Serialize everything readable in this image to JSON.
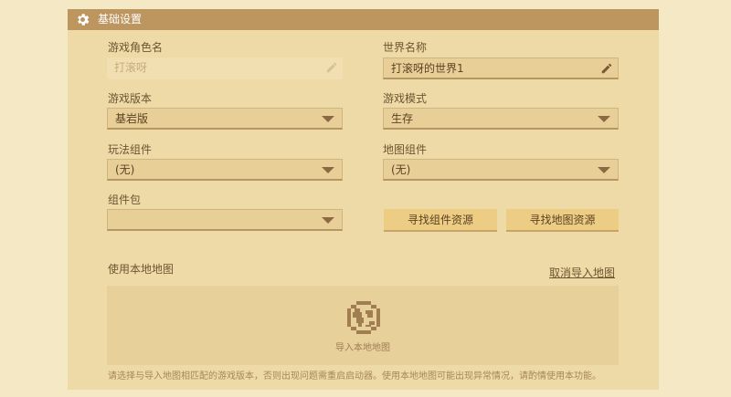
{
  "panel": {
    "title": "基础设置",
    "icon": "gear-icon"
  },
  "fields": {
    "character_name": {
      "label": "游戏角色名",
      "value": "打滚呀",
      "disabled": true
    },
    "world_name": {
      "label": "世界名称",
      "value": "打滚呀的世界1"
    },
    "game_version": {
      "label": "游戏版本",
      "value": "基岩版"
    },
    "game_mode": {
      "label": "游戏模式",
      "value": "生存"
    },
    "gameplay_component": {
      "label": "玩法组件",
      "value": "(无)"
    },
    "map_component": {
      "label": "地图组件",
      "value": "(无)"
    },
    "component_pack": {
      "label": "组件包",
      "value": ""
    }
  },
  "buttons": {
    "find_component_resources": "寻找组件资源",
    "find_map_resources": "寻找地图资源"
  },
  "local_map": {
    "label": "使用本地地图",
    "cancel_link": "取消导入地图",
    "import_text": "导入本地地图"
  },
  "notice": "请选择与导入地图相匹配的游戏版本，否则出现问题需重启启动器。使用本地地图可能出现异常情况，请酌情使用本功能。",
  "colors": {
    "header": "#bd955f",
    "panel": "#eedaa7",
    "button": "#eccd83"
  }
}
